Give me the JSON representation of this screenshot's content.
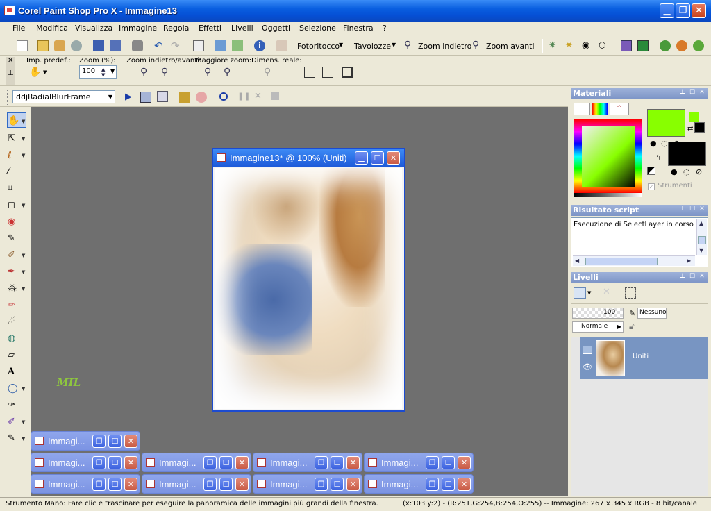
{
  "window": {
    "title": "Corel Paint Shop Pro X - Immagine13"
  },
  "menu": [
    "File",
    "Modifica",
    "Visualizza",
    "Immagine",
    "Regola",
    "Effetti",
    "Livelli",
    "Oggetti",
    "Selezione",
    "Finestra",
    "?"
  ],
  "toolbar": {
    "fotoritocco": "Fotoritocco",
    "tavolozze": "Tavolozze",
    "zoom_out": "Zoom indietro",
    "zoom_in": "Zoom avanti"
  },
  "options": {
    "preset_label": "Imp. predef.:",
    "zoom_label": "Zoom (%):",
    "zoom_value": "100",
    "zoom_inout_label": "Zoom indietro/avanti:",
    "more_zoom_label": "Maggiore zoom:",
    "real_size_label": "Dimens. reale:"
  },
  "script": {
    "name": "ddjRadialBlurFrame"
  },
  "document": {
    "title": "Immagine13* @ 100% (Uniti)"
  },
  "minimized": {
    "label": "Immagi..."
  },
  "watermark": "MIL",
  "materials": {
    "title": "Materiali",
    "foreground": "#88ff00",
    "background": "#000000",
    "tools_label": "Strumenti"
  },
  "script_output": {
    "title": "Risultato script",
    "text": "Esecuzione di SelectLayer in corso"
  },
  "layers": {
    "title": "Livelli",
    "opacity": "100",
    "blend_mode": "Normale",
    "mask": "Nessuno",
    "layer_name": "Uniti"
  },
  "status": {
    "hint": "Strumento Mano: Fare clic e trascinare per eseguire la panoramica delle immagini più grandi della finestra.",
    "info": "(x:103 y:2) - (R:251,G:254,B:254,O:255) -- Immagine:  267 x 345 x RGB - 8 bit/canale"
  }
}
